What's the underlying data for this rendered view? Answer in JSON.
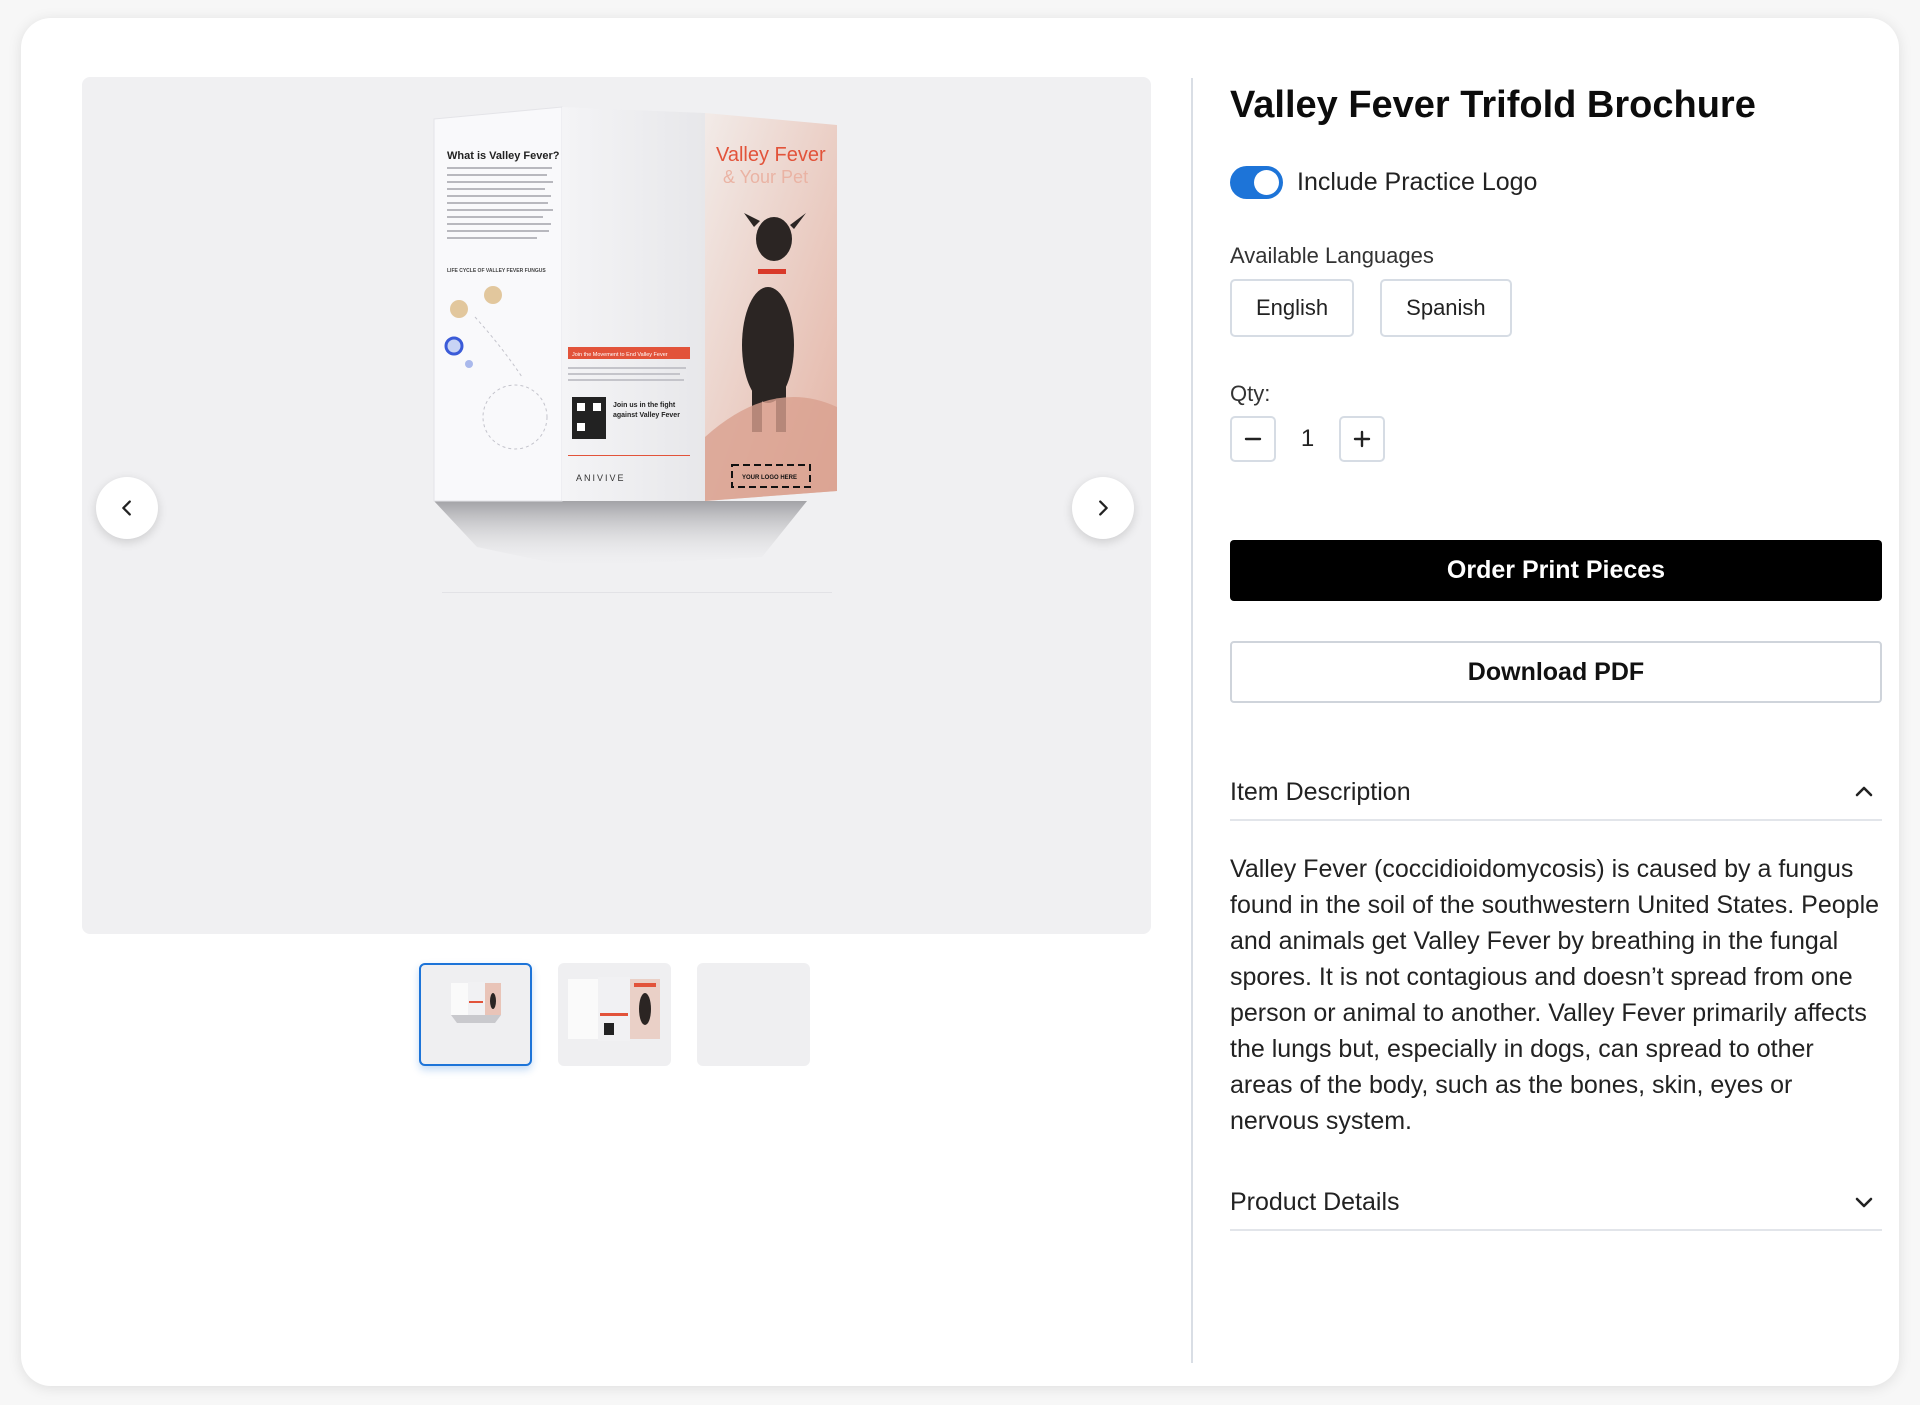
{
  "product": {
    "title": "Valley Fever Trifold Brochure"
  },
  "logo_toggle": {
    "label": "Include Practice Logo",
    "on": true
  },
  "languages": {
    "label": "Available Languages",
    "options": [
      "English",
      "Spanish"
    ]
  },
  "quantity": {
    "label": "Qty:",
    "value": "1",
    "minus": "−",
    "plus": "+"
  },
  "actions": {
    "order_label": "Order Print Pieces",
    "download_label": "Download PDF"
  },
  "accordion": {
    "description_title": "Item Description",
    "description_text": "Valley Fever  (coccidioidomycosis) is caused by a fungus found in the soil of the southwestern United States. People and animals get Valley Fever by breathing in the fungal spores. It is not contagious and doesn’t spread from one person or animal to another. Valley Fever primarily affects the lungs but, especially in dogs, can spread to other areas of the body, such as the bones, skin, eyes or nervous system.",
    "details_title": "Product Details"
  },
  "brochure": {
    "panel_heading": "What is Valley Fever?",
    "lifecycle_heading": "LIFE CYCLE OF VALLEY FEVER FUNGUS",
    "cover_title_1": "Valley Fever",
    "cover_title_2": "& Your Pet",
    "movement_banner": "Join the Movement to End Valley Fever",
    "join_text_1": "Join us in the fight",
    "join_text_2": "against Valley Fever",
    "brand": "ANIVIVE",
    "logo_placeholder": "YOUR LOGO HERE"
  },
  "colors": {
    "accent": "#1d74d8",
    "brand_orange": "#e2533a"
  }
}
